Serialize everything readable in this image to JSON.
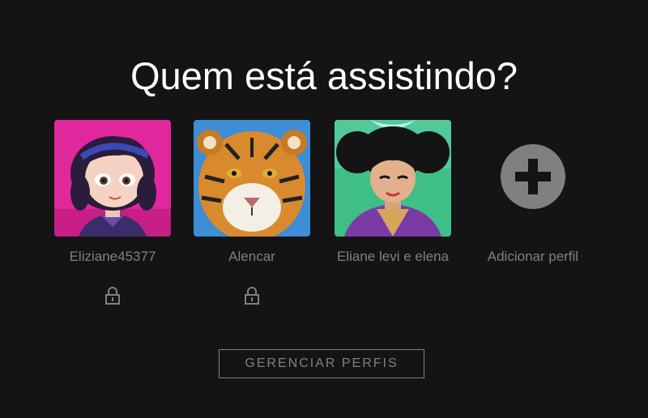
{
  "title": "Quem está assistindo?",
  "profiles": [
    {
      "name": "Eliziane45377",
      "locked": true,
      "avatar": "animated-girl-avatar"
    },
    {
      "name": "Alencar",
      "locked": true,
      "avatar": "tiger-avatar"
    },
    {
      "name": "Eliane levi e elena",
      "locked": false,
      "avatar": "animated-warrior-avatar"
    }
  ],
  "add_profile": {
    "label": "Adicionar perfil",
    "icon": "plus-circle-icon"
  },
  "manage_button": {
    "label": "GERENCIAR PERFIS"
  },
  "colors": {
    "background": "#141414",
    "title": "#ffffff",
    "muted": "#808080",
    "add_circle": "#808080"
  }
}
